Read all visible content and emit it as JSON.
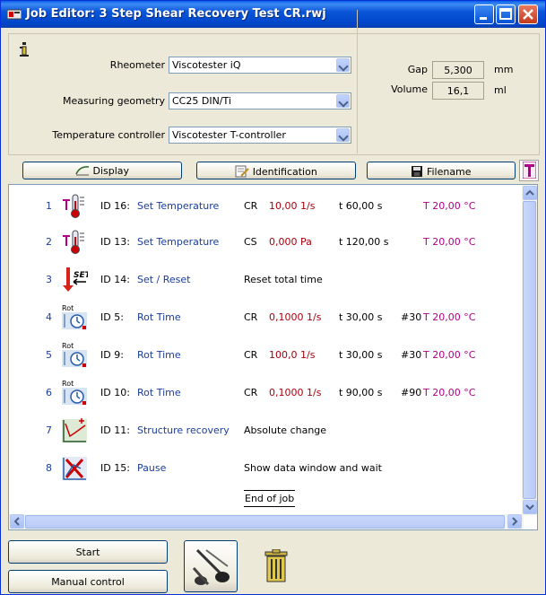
{
  "window": {
    "title": "Job Editor: 3 Step Shear Recovery Test CR.rwj"
  },
  "config": {
    "rheometer_label": "Rheometer",
    "rheometer_value": "Viscotester iQ",
    "geometry_label": "Measuring geometry",
    "geometry_value": "CC25 DIN/Ti",
    "temp_controller_label": "Temperature controller",
    "temp_controller_value": "Viscotester T-controller",
    "gap_label": "Gap",
    "gap_value": "5,300",
    "gap_unit": "mm",
    "volume_label": "Volume",
    "volume_value": "16,1",
    "volume_unit": "ml"
  },
  "toolbar": {
    "display_label": "Display",
    "identification_label": "Identification",
    "filename_label": "Filename"
  },
  "rows": [
    {
      "num": "1",
      "icon": "thermometer-icon",
      "id": "ID 16:",
      "name": "Set Temperature",
      "mode": "CR",
      "value": "10,00 1/s",
      "time": "t 60,00 s",
      "count": "",
      "temp": "T 20,00 °C"
    },
    {
      "num": "2",
      "icon": "thermometer-icon",
      "id": "ID 13:",
      "name": "Set Temperature",
      "mode": "CS",
      "value": "0,000 Pa",
      "time": "t 120,00 s",
      "count": "",
      "temp": "T 20,00 °C"
    },
    {
      "num": "3",
      "icon": "set-reset-icon",
      "id": "ID 14:",
      "name": "Set / Reset",
      "desc": "Reset total time"
    },
    {
      "num": "4",
      "icon": "rot-time-icon",
      "id": "ID 5:",
      "name": "Rot Time",
      "mode": "CR",
      "value": "0,1000 1/s",
      "time": "t 30,00 s",
      "count": "#30",
      "temp": "T 20,00 °C"
    },
    {
      "num": "5",
      "icon": "rot-time-icon",
      "id": "ID 9:",
      "name": "Rot Time",
      "mode": "CR",
      "value": "100,0 1/s",
      "time": "t 30,00 s",
      "count": "#30",
      "temp": "T 20,00 °C"
    },
    {
      "num": "6",
      "icon": "rot-time-icon",
      "id": "ID 10:",
      "name": "Rot Time",
      "mode": "CR",
      "value": "0,1000 1/s",
      "time": "t 90,00 s",
      "count": "#90",
      "temp": "T 20,00 °C"
    },
    {
      "num": "7",
      "icon": "structure-recovery-icon",
      "id": "ID 11:",
      "name": "Structure recovery",
      "desc": "Absolute change"
    },
    {
      "num": "8",
      "icon": "pause-icon",
      "id": "ID 15:",
      "name": "Pause",
      "desc": "Show data window and wait"
    }
  ],
  "end_of_job": "End of job",
  "bottom": {
    "start_label": "Start",
    "manual_label": "Manual control"
  },
  "icons": {
    "rot_label": "Rot",
    "set_label": "SET"
  }
}
